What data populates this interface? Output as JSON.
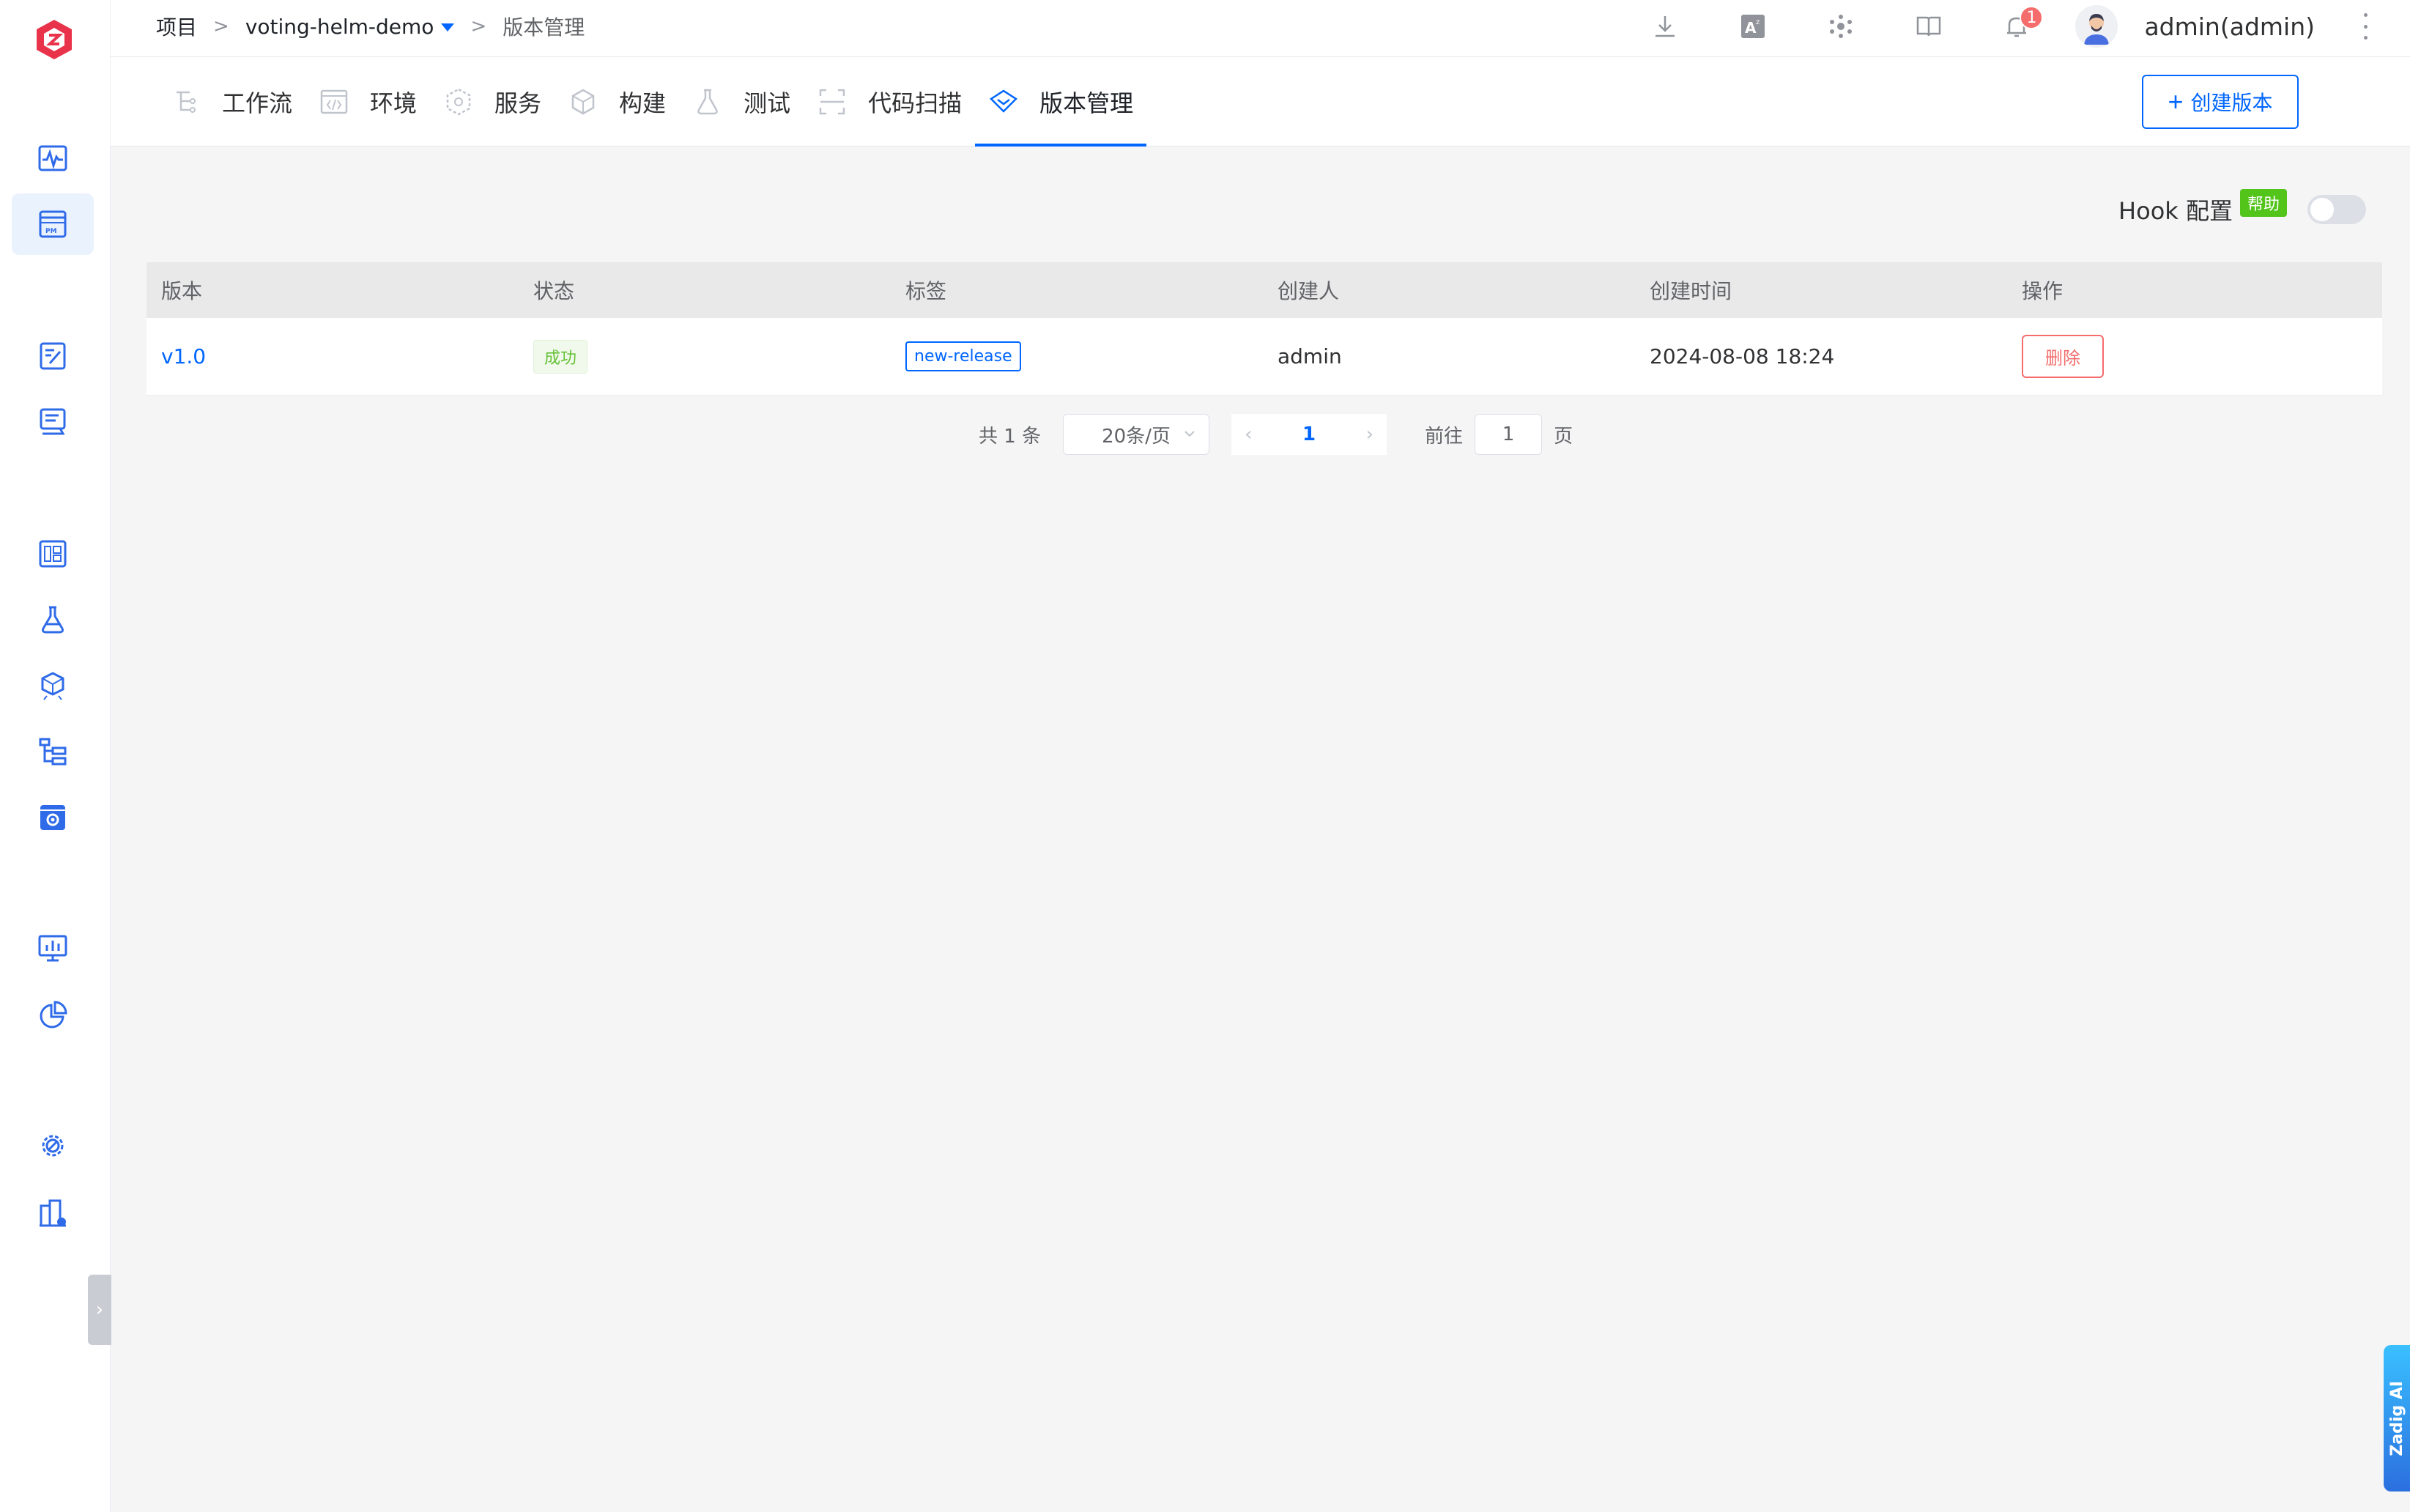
{
  "breadcrumb": {
    "root": "项目",
    "sep1": ">",
    "project": "voting-helm-demo",
    "sep2": ">",
    "current": "版本管理"
  },
  "header": {
    "notification_count": "1",
    "username": "admin(admin)"
  },
  "tabs": [
    {
      "label": "工作流",
      "icon": "workflow-icon"
    },
    {
      "label": "环境",
      "icon": "environment-icon"
    },
    {
      "label": "服务",
      "icon": "service-icon"
    },
    {
      "label": "构建",
      "icon": "build-icon"
    },
    {
      "label": "测试",
      "icon": "test-icon"
    },
    {
      "label": "代码扫描",
      "icon": "code-scan-icon"
    },
    {
      "label": "版本管理",
      "icon": "version-icon",
      "active": true
    }
  ],
  "toolbar": {
    "create_label": "创建版本"
  },
  "hook": {
    "label": "Hook 配置",
    "help": "帮助",
    "enabled": false
  },
  "table": {
    "headers": [
      "版本",
      "状态",
      "标签",
      "创建人",
      "创建时间",
      "操作"
    ],
    "rows": [
      {
        "version": "v1.0",
        "status": "成功",
        "tag": "new-release",
        "creator": "admin",
        "created_at": "2024-08-08 18:24",
        "action": "删除"
      }
    ]
  },
  "pagination": {
    "total": "共 1 条",
    "page_size": "20条/页",
    "current_page": "1",
    "goto_prefix": "前往",
    "goto_value": "1",
    "goto_suffix": "页"
  },
  "ai_button": "Zadig AI",
  "colors": {
    "primary": "#0066ff",
    "success": "#67c23a",
    "danger": "#f56c6c",
    "brand": "#e8334a"
  }
}
